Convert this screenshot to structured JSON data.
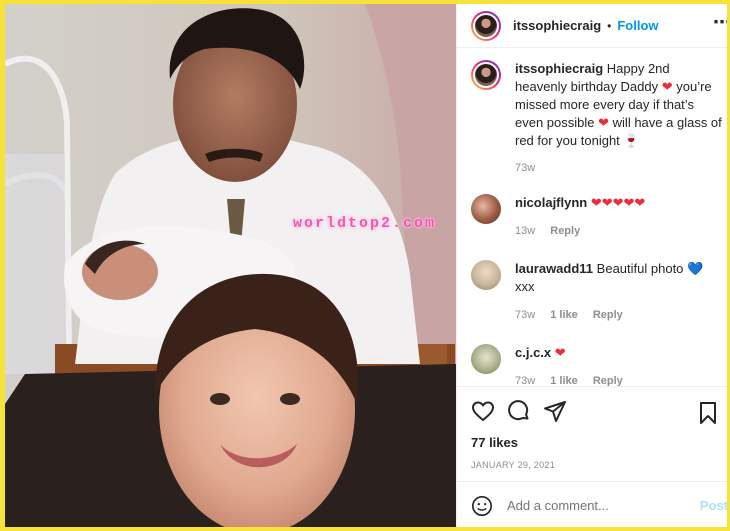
{
  "watermark": "worldtop2.com",
  "header": {
    "username": "itssophiecraig",
    "separator": "•",
    "follow_label": "Follow",
    "more_icon": "ellipsis-icon"
  },
  "caption": {
    "username": "itssophiecraig",
    "text_1": "Happy 2nd heavenly birthday Daddy",
    "text_2": "you’re missed more every day if that’s even possible",
    "text_3": "will have a glass of red for you tonight",
    "time": "73w"
  },
  "comments": [
    {
      "username": "nicolajflynn",
      "text": "",
      "hearts": "❤❤❤❤❤",
      "time": "13w",
      "likes": "",
      "reply": "Reply"
    },
    {
      "username": "laurawadd11",
      "text": "Beautiful photo",
      "hearts": "💙",
      "suffix": "xxx",
      "time": "73w",
      "likes": "1 like",
      "reply": "Reply"
    },
    {
      "username": "c.j.c.x",
      "text": "",
      "hearts": "❤",
      "time": "73w",
      "likes": "1 like",
      "reply": "Reply"
    }
  ],
  "likes": "77 likes",
  "date": "JANUARY 29, 2021",
  "add_comment": {
    "placeholder": "Add a comment...",
    "post_label": "Post"
  },
  "colors": {
    "accent": "#0095f6",
    "heart": "#ed2b3b",
    "frame": "#f7e23a"
  }
}
